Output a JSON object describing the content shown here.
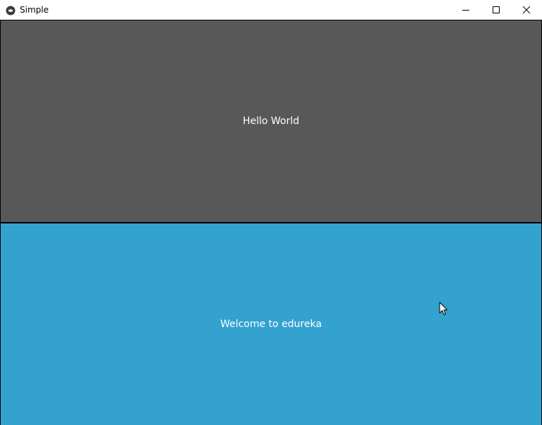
{
  "window": {
    "title": "Simple",
    "app_icon": "app-logo-icon",
    "controls": {
      "minimize_icon": "minimize-icon",
      "maximize_icon": "maximize-icon",
      "close_icon": "close-icon"
    }
  },
  "panes": [
    {
      "text": "Hello World",
      "background": "#585858",
      "text_color": "#ffffff"
    },
    {
      "text": "Welcome to edureka",
      "background": "#33a2cf",
      "text_color": "#ffffff"
    }
  ],
  "colors": {
    "divider": "#000000",
    "titlebar": "#ffffff"
  },
  "cursor_icon": "mouse-pointer-icon"
}
